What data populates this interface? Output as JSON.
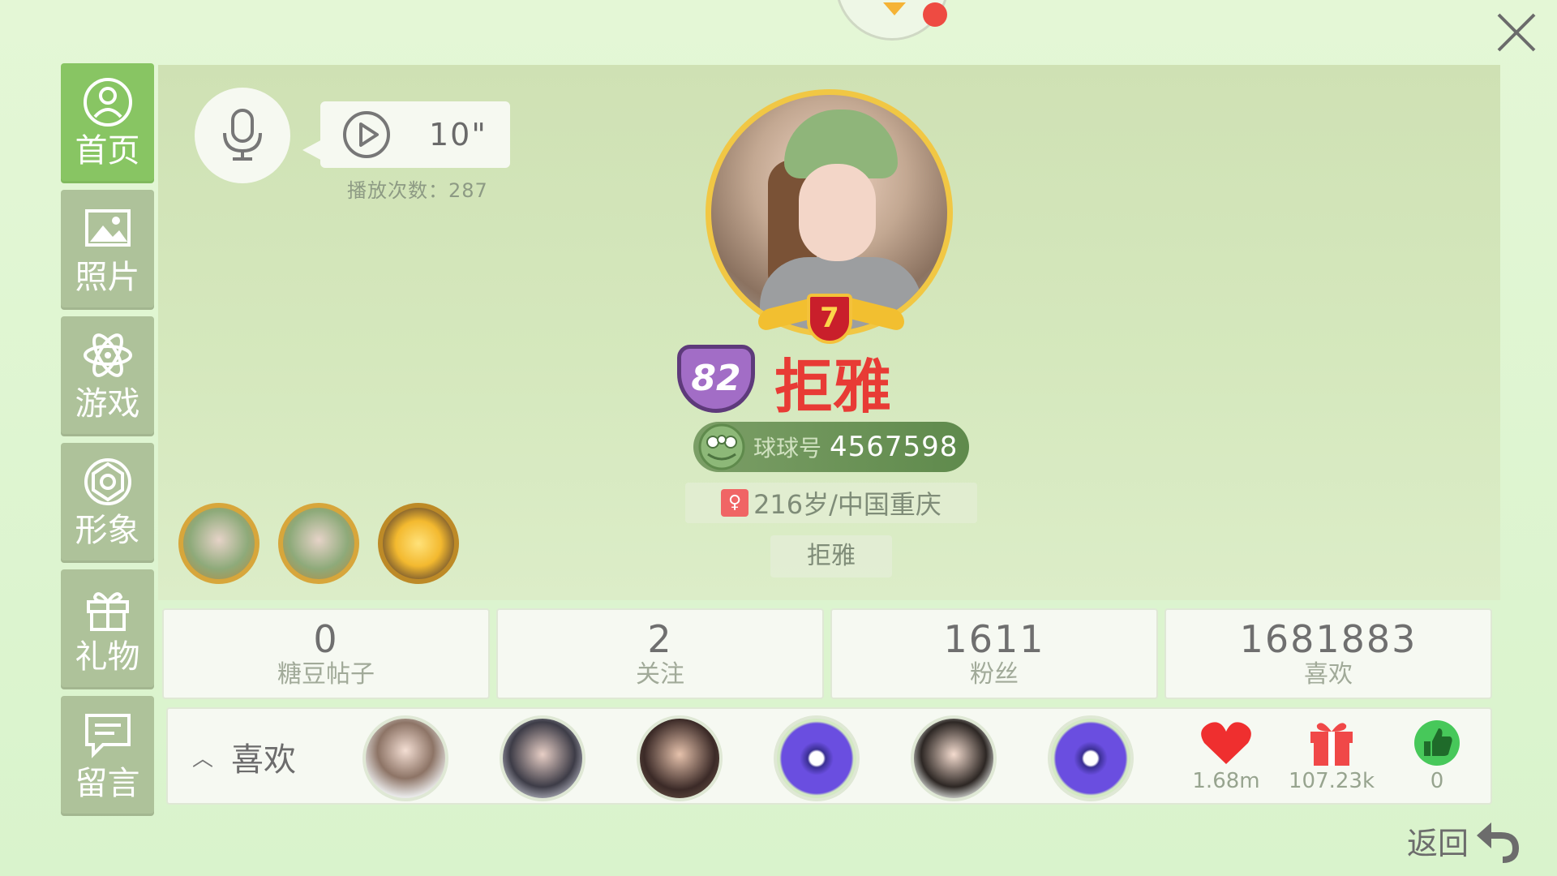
{
  "sidebar": {
    "items": [
      {
        "label": "首页",
        "icon": "user-icon",
        "active": true
      },
      {
        "label": "照片",
        "icon": "photo-icon",
        "active": false
      },
      {
        "label": "游戏",
        "icon": "atom-icon",
        "active": false
      },
      {
        "label": "形象",
        "icon": "avatar-icon",
        "active": false
      },
      {
        "label": "礼物",
        "icon": "gift-icon",
        "active": false
      },
      {
        "label": "留言",
        "icon": "message-icon",
        "active": false
      }
    ]
  },
  "profile": {
    "voice_duration": "10\"",
    "play_count": "播放次数：287",
    "rank": "7",
    "level": "82",
    "nickname": "拒雅",
    "id_label": "球球号",
    "id_number": "4567598",
    "location": "216岁/中国重庆",
    "signature": "拒雅"
  },
  "stats": [
    {
      "value": "0",
      "label": "糖豆帖子"
    },
    {
      "value": "2",
      "label": "关注"
    },
    {
      "value": "1611",
      "label": "粉丝"
    },
    {
      "value": "1681883",
      "label": "喜欢"
    }
  ],
  "likes": {
    "title": "喜欢",
    "mini": [
      {
        "icon": "heart-icon",
        "value": "1.68m"
      },
      {
        "icon": "gift-icon",
        "value": "107.23k"
      },
      {
        "icon": "thumbs-up-icon",
        "value": "0"
      }
    ]
  },
  "back_label": "返回",
  "colors": {
    "accent": "#88c563",
    "nickname": "#e83b35",
    "background": "#e4f7d6"
  }
}
